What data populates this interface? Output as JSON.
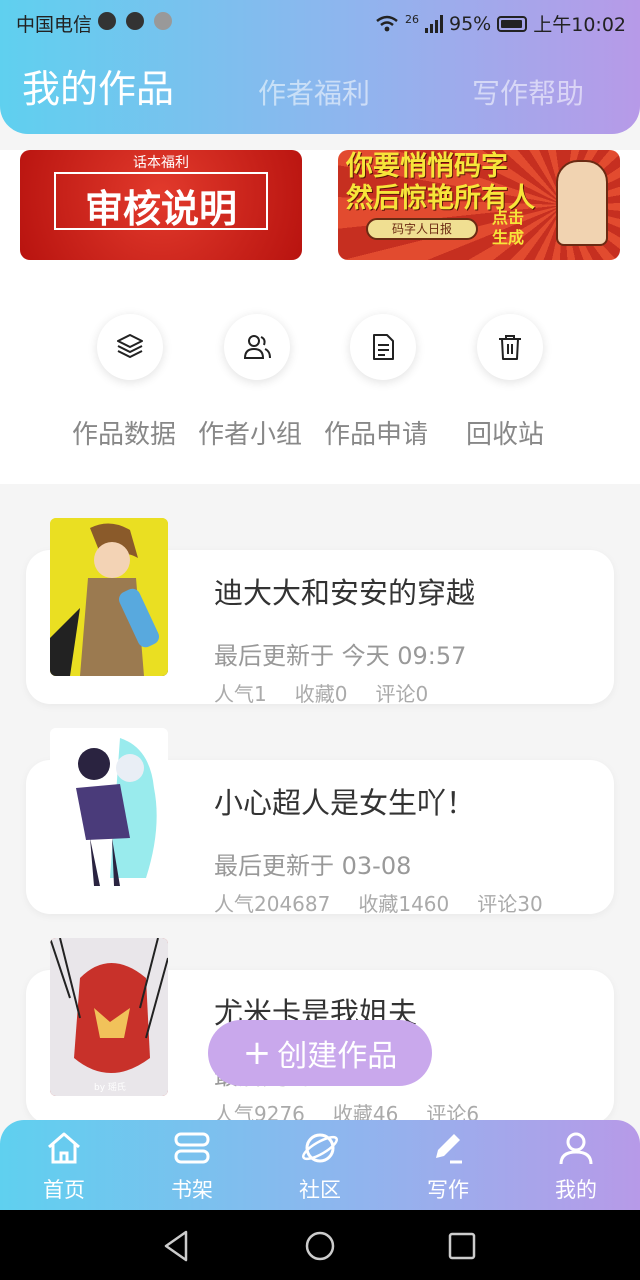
{
  "status": {
    "carrier": "中国电信",
    "network": "26",
    "battery": "95%",
    "time": "上午10:02"
  },
  "tabs": [
    {
      "label": "我的作品",
      "active": true
    },
    {
      "label": "作者福利",
      "active": false
    },
    {
      "label": "写作帮助",
      "active": false
    }
  ],
  "banners": {
    "left": {
      "tag": "话本福利",
      "title": "审核说明"
    },
    "right": {
      "line1": "你要悄悄码字",
      "line2": "然后惊艳所有人",
      "pill": "码字人日报",
      "action": "点击生成"
    }
  },
  "quick_actions": [
    {
      "label": "作品数据",
      "icon": "layers-icon"
    },
    {
      "label": "作者小组",
      "icon": "group-icon"
    },
    {
      "label": "作品申请",
      "icon": "document-icon"
    },
    {
      "label": "回收站",
      "icon": "trash-icon"
    }
  ],
  "works": [
    {
      "title": "迪大大和安安的穿越",
      "updated": "最后更新于 今天 09:57",
      "stats": [
        "人气1",
        "收藏0",
        "评论0"
      ]
    },
    {
      "title": "小心超人是女生吖！",
      "updated": "最后更新于 03-08",
      "stats": [
        "人气204687",
        "收藏1460",
        "评论30"
      ]
    },
    {
      "title": "尤米卡是我姐夫",
      "updated": "最后更新于",
      "stats": [
        "人气9276",
        "收藏46",
        "评论6"
      ]
    }
  ],
  "cover_watermark": "by 瑶氏",
  "create_button": {
    "label": "创建作品",
    "icon": "plus-icon"
  },
  "bottom_nav": [
    {
      "label": "首页",
      "icon": "home-icon"
    },
    {
      "label": "书架",
      "icon": "bookshelf-icon"
    },
    {
      "label": "社区",
      "icon": "planet-icon"
    },
    {
      "label": "写作",
      "icon": "pen-icon"
    },
    {
      "label": "我的",
      "icon": "user-icon"
    }
  ],
  "colors": {
    "gradient_start": "#5fd0ef",
    "gradient_end": "#b79ae8",
    "create_button": "#c9a8ec",
    "banner_red": "#c62f20"
  }
}
